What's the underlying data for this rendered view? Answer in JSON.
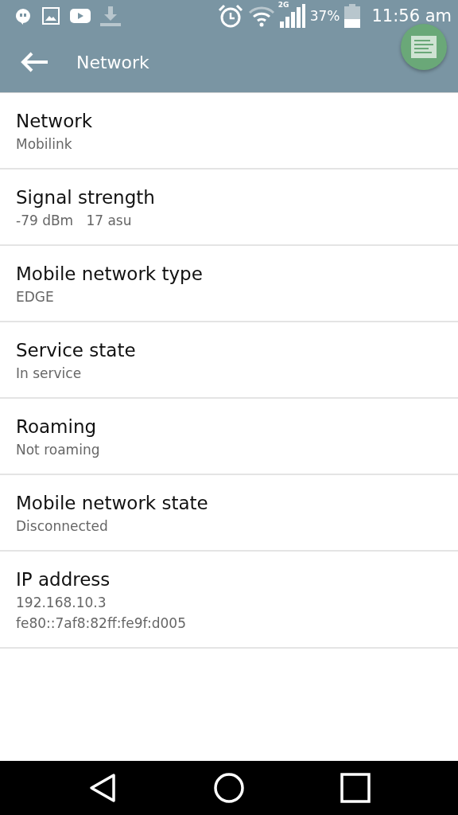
{
  "status_bar": {
    "battery": "37%",
    "time": "11:56 am",
    "network_type": "2G"
  },
  "toolbar": {
    "title": "Network"
  },
  "items": [
    {
      "title": "Network",
      "lines": [
        "Mobilink"
      ]
    },
    {
      "title": "Signal strength",
      "lines": [
        "-79 dBm   17 asu"
      ]
    },
    {
      "title": "Mobile network type",
      "lines": [
        "EDGE"
      ]
    },
    {
      "title": "Service state",
      "lines": [
        "In service"
      ]
    },
    {
      "title": "Roaming",
      "lines": [
        "Not roaming"
      ]
    },
    {
      "title": "Mobile network state",
      "lines": [
        "Disconnected"
      ]
    },
    {
      "title": "IP address",
      "lines": [
        "192.168.10.3",
        "fe80::7af8:82ff:fe9f:d005"
      ]
    }
  ]
}
